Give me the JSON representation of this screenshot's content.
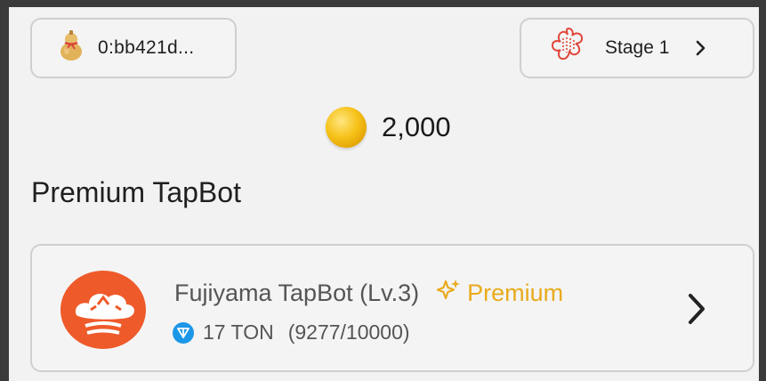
{
  "header": {
    "wallet": {
      "label": "0:bb421d...",
      "icon": "gourd-icon"
    },
    "stage": {
      "label": "Stage 1",
      "icon": "sakura-stamp-icon"
    }
  },
  "balance": {
    "amount": "2,000",
    "icon": "gold-coin-icon"
  },
  "section": {
    "title": "Premium TapBot"
  },
  "tapbot": {
    "name": "Fujiyama TapBot (Lv.3)",
    "badge": "Premium",
    "price": "17 TON",
    "progress": "(9277/10000)",
    "colors": {
      "avatar": "#ef5a2a",
      "premium": "#e9aa1b",
      "ton": "#1c97e8"
    }
  }
}
